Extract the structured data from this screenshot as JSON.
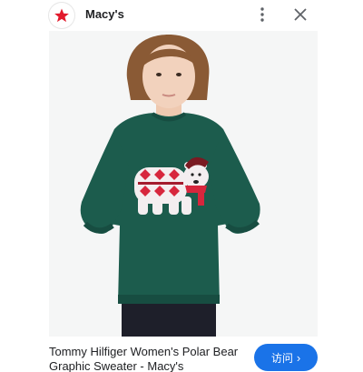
{
  "header": {
    "site_name": "Macy's",
    "logo_icon": "red-star-icon",
    "more_icon": "more-vert-icon",
    "close_icon": "close-icon"
  },
  "product": {
    "title": "Tommy Hilfiger Women's Polar Bear Graphic Sweater - Macy's",
    "image_description_icon": "model-wearing-green-polar-bear-sweater"
  },
  "footer": {
    "visit_label": "访问",
    "visit_icon": "chevron-right-icon"
  },
  "colors": {
    "brand_red": "#e21a2c",
    "sweater_green": "#1c5c4d",
    "accent_blue": "#1a73e8"
  }
}
